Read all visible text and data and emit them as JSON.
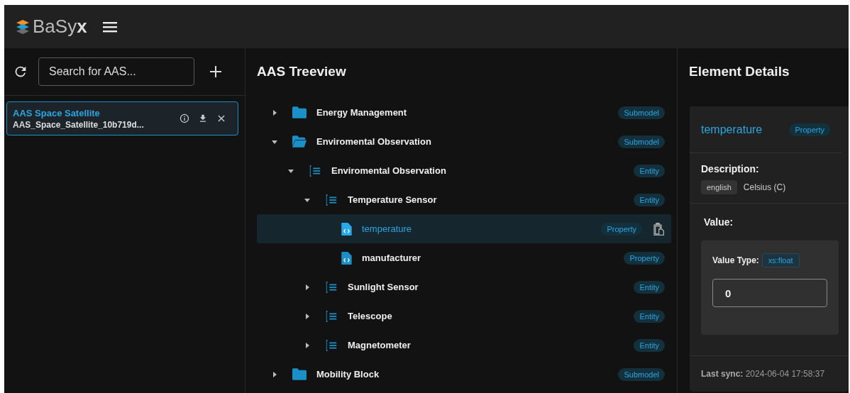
{
  "app": {
    "brand_light": "BaSy",
    "brand_bold": "x"
  },
  "sidebar": {
    "search": {
      "placeholder": "Search for AAS..."
    },
    "items": [
      {
        "name": "AAS Space Satellite",
        "id_short": "AAS_Space_Satellite_10b719d...",
        "selected": true
      }
    ]
  },
  "treeview": {
    "title": "AAS Treeview",
    "nodes": [
      {
        "label": "Energy Management",
        "kind": "submodel",
        "badge": "Submodel",
        "expanded": false,
        "selected": false
      },
      {
        "label": "Enviromental Observation",
        "kind": "submodel",
        "badge": "Submodel",
        "expanded": true,
        "selected": false,
        "children": [
          {
            "label": "Enviromental Observation",
            "kind": "entity",
            "badge": "Entity",
            "expanded": true,
            "selected": false,
            "children": [
              {
                "label": "Temperature Sensor",
                "kind": "entity",
                "badge": "Entity",
                "expanded": true,
                "selected": false,
                "children": [
                  {
                    "label": "temperature",
                    "kind": "property",
                    "badge": "Property",
                    "selected": true
                  },
                  {
                    "label": "manufacturer",
                    "kind": "property",
                    "badge": "Property",
                    "selected": false
                  }
                ]
              },
              {
                "label": "Sunlight Sensor",
                "kind": "entity",
                "badge": "Entity",
                "expanded": false,
                "selected": false
              },
              {
                "label": "Telescope",
                "kind": "entity",
                "badge": "Entity",
                "expanded": false,
                "selected": false
              },
              {
                "label": "Magnetometer",
                "kind": "entity",
                "badge": "Entity",
                "expanded": false,
                "selected": false
              }
            ]
          }
        ]
      },
      {
        "label": "Mobility Block",
        "kind": "submodel",
        "badge": "Submodel",
        "expanded": false,
        "selected": false
      }
    ]
  },
  "details": {
    "title": "Element Details",
    "name": "temperature",
    "badge": "Property",
    "description_label": "Description:",
    "description": [
      {
        "lang": "english",
        "text": "Celsius (C)"
      }
    ],
    "value_label": "Value:",
    "value_type_label": "Value Type:",
    "value_type": "xs:float",
    "value": "0",
    "last_sync_label": "Last sync:",
    "last_sync": "2024-06-04 17:58:37"
  }
}
